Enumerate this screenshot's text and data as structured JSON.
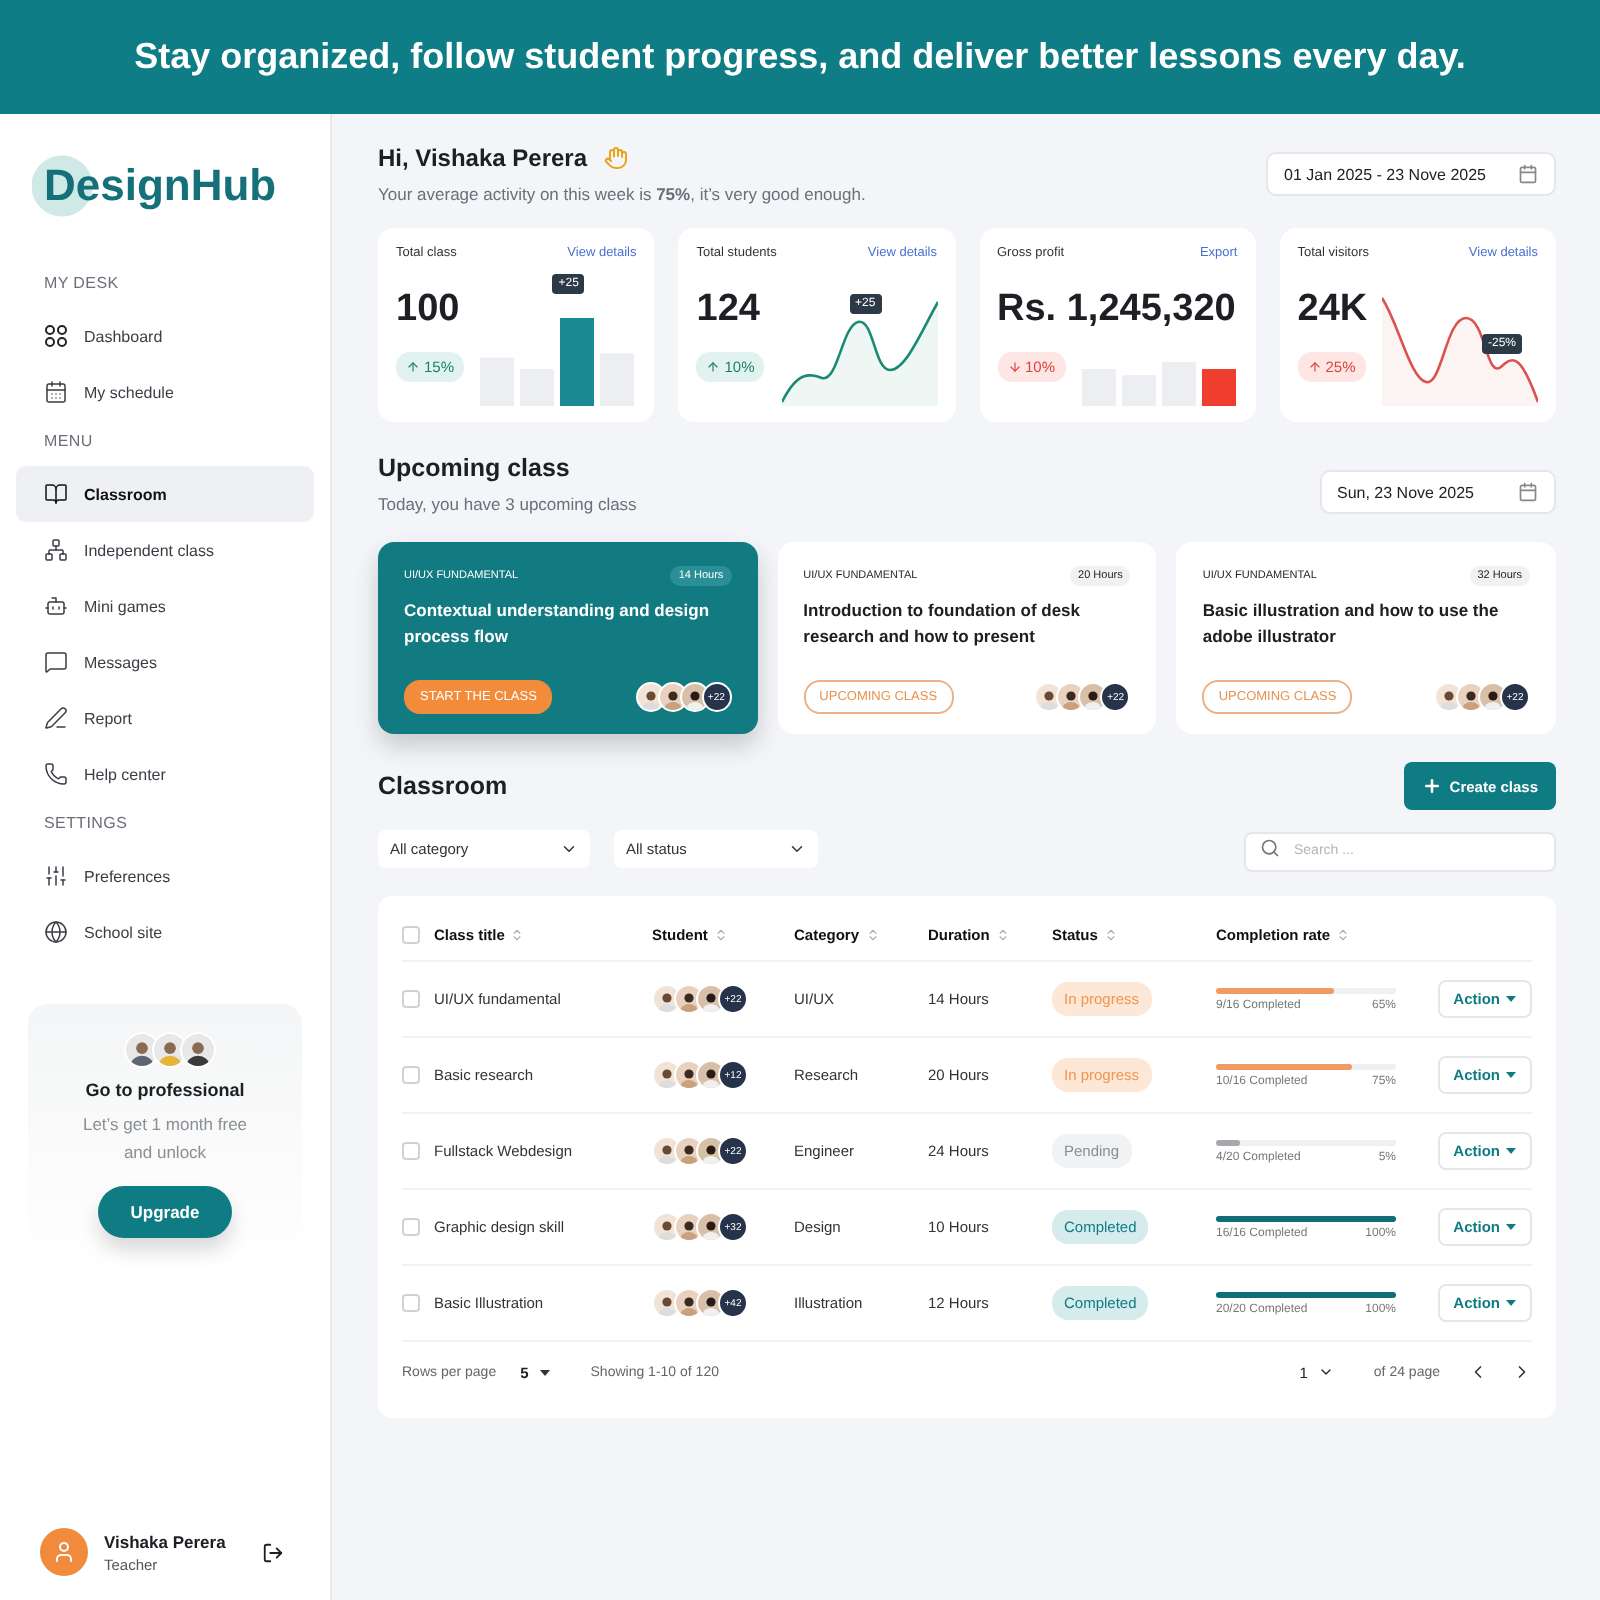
{
  "banner": {
    "text": "Stay organized, follow student progress, and deliver better lessons every day."
  },
  "sidebar": {
    "logo": "DesignHub",
    "sections": [
      {
        "title": "MY DESK",
        "items": [
          {
            "label": "Dashboard",
            "selected": false
          },
          {
            "label": "My schedule",
            "selected": false
          }
        ]
      },
      {
        "title": "MENU",
        "items": [
          {
            "label": "Classroom",
            "selected": true
          },
          {
            "label": "Independent class",
            "selected": false
          },
          {
            "label": "Mini games",
            "selected": false
          },
          {
            "label": "Messages",
            "selected": false
          },
          {
            "label": "Report",
            "selected": false
          },
          {
            "label": "Help center",
            "selected": false
          }
        ]
      },
      {
        "title": "SETTINGS",
        "items": [
          {
            "label": "Preferences",
            "selected": false
          },
          {
            "label": "School site",
            "selected": false
          }
        ]
      }
    ],
    "promo": {
      "title": "Go to professional",
      "text": "Let’s get  1 month free and unlock",
      "button": "Upgrade"
    },
    "user": {
      "name": "Vishaka Perera",
      "role": "Teacher"
    }
  },
  "header": {
    "greeting": "Hi, Vishaka Perera",
    "subtitle": "Your average activity on this week is **75%**, it’s very good enough.",
    "date_range": "01 Jan 2025 - 23 Nove 2025"
  },
  "stats": [
    {
      "title": "Total class",
      "link": "View details",
      "value": "100",
      "change": "15%",
      "rising": true,
      "positive": true,
      "tooltip": "+25",
      "chart": {
        "kind": "bars",
        "color": "#1b8a92"
      }
    },
    {
      "title": "Total students",
      "link": "View details",
      "value": "124",
      "change": "10%",
      "rising": true,
      "positive": true,
      "tooltip": "+25",
      "chart": {
        "kind": "line",
        "color": "#1b8a72"
      }
    },
    {
      "title": "Gross profit",
      "link": "Export",
      "value": "Rs. 1,245,320",
      "change": "10%",
      "rising": false,
      "positive": false,
      "chart": {
        "kind": "bars",
        "color": "#ef3e2e"
      }
    },
    {
      "title": "Total visitors",
      "link": "View details",
      "value": "24K",
      "change": "25%",
      "rising": true,
      "positive": false,
      "tooltip": "-25%",
      "chart": {
        "kind": "line",
        "color": "#d9534f"
      }
    }
  ],
  "upcoming": {
    "title": "Upcoming class",
    "subtitle": "Today, you have 3 upcoming  class",
    "date": "Sun, 23 Nove 2025",
    "classes": [
      {
        "tag": "UI/UX FUNDAMENTAL",
        "hours": "14 Hours",
        "title": "Contextual understanding and design process flow",
        "button": "START THE CLASS",
        "extra": "+22",
        "selected": true
      },
      {
        "tag": "UI/UX FUNDAMENTAL",
        "hours": "20 Hours",
        "title": "Introduction to foundation of desk research and how to present",
        "button": "UPCOMING CLASS",
        "extra": "+22",
        "selected": false
      },
      {
        "tag": "UI/UX FUNDAMENTAL",
        "hours": "32 Hours",
        "title": "Basic illustration and how to use the adobe illustrator",
        "button": "UPCOMING CLASS",
        "extra": "+22",
        "selected": false
      }
    ]
  },
  "classroom": {
    "title": "Classroom",
    "create_button": "Create class",
    "filters": [
      "All category",
      "All status"
    ],
    "search": {
      "placeholder": "Search ..."
    },
    "columns": [
      "Class title",
      "Student",
      "Category",
      "Duration",
      "Status",
      "Completion rate"
    ],
    "header_checked": false,
    "rows": [
      {
        "checked": false,
        "title": "UI/UX fundamental",
        "extra": "+22",
        "category": "UI/UX",
        "duration": "14 Hours",
        "status": {
          "label": "In progress",
          "kind": "progress"
        },
        "completed": "9/16 Completed",
        "percent": "65%",
        "level": 0.65,
        "action": "Action"
      },
      {
        "checked": false,
        "title": "Basic research",
        "extra": "+12",
        "category": "Research",
        "duration": "20 Hours",
        "status": {
          "label": "In progress",
          "kind": "progress"
        },
        "completed": "10/16 Completed",
        "percent": "75%",
        "level": 0.75,
        "action": "Action"
      },
      {
        "checked": false,
        "title": "Fullstack Webdesign",
        "extra": "+22",
        "category": "Engineer",
        "duration": "24 Hours",
        "status": {
          "label": "Pending",
          "kind": "pending"
        },
        "completed": "4/20 Completed",
        "percent": "5%",
        "level": 0.13,
        "action": "Action"
      },
      {
        "checked": false,
        "title": "Graphic design skill",
        "extra": "+32",
        "category": "Design",
        "duration": "10 Hours",
        "status": {
          "label": "Completed",
          "kind": "completed"
        },
        "completed": "16/16 Completed",
        "percent": "100%",
        "level": 1,
        "action": "Action"
      },
      {
        "checked": false,
        "title": "Basic Illustration",
        "extra": "+42",
        "category": "Illustration",
        "duration": "12 Hours",
        "status": {
          "label": "Completed",
          "kind": "completed"
        },
        "completed": "20/20 Completed",
        "percent": "100%",
        "level": 1,
        "action": "Action"
      }
    ],
    "footer": {
      "rows_label": "Rows per page",
      "rows_value": "5",
      "showing": "Showing 1-10 of 120",
      "page": "1",
      "of_pages": "of 24 page"
    }
  }
}
